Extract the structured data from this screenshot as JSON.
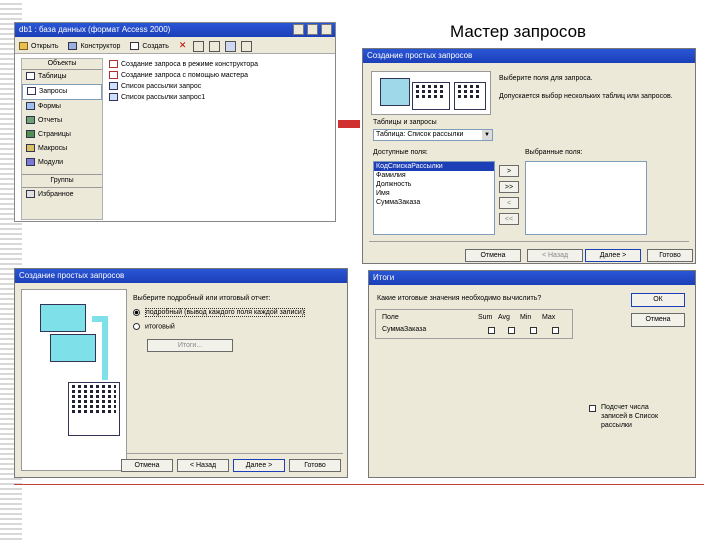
{
  "page": {
    "heading": "Мастер запросов"
  },
  "db_window": {
    "title": "db1 : база данных (формат Access 2000)",
    "toolbar": {
      "open": "Открыть",
      "designer": "Конструктор",
      "create": "Создать"
    },
    "objects_header": "Объекты",
    "objects": [
      "Таблицы",
      "Запросы",
      "Формы",
      "Отчеты",
      "Страницы",
      "Макросы",
      "Модули"
    ],
    "groups_header": "Группы",
    "groups": [
      "Избранное"
    ],
    "list_items": [
      "Создание запроса в режиме конструктора",
      "Создание запроса с помощью мастера",
      "Список рассылки запрос",
      "Список рассылки запрос1"
    ]
  },
  "wizard1": {
    "title": "Создание простых запросов",
    "instruction": "Выберите поля для запроса.",
    "hint": "Допускается выбор нескольких таблиц или запросов.",
    "tables_label": "Таблицы и запросы",
    "tables_value": "Таблица: Список рассылки",
    "available_label": "Доступные поля:",
    "selected_label": "Выбранные поля:",
    "available_fields": [
      "КодСпискаРассылки",
      "Фамилия",
      "Должность",
      "Имя",
      "СуммаЗаказа"
    ],
    "move_buttons": [
      ">",
      ">>",
      "<",
      "<<"
    ],
    "buttons": {
      "cancel": "Отмена",
      "back": "< Назад",
      "next": "Далее >",
      "finish": "Готово"
    }
  },
  "wizard2": {
    "title": "Создание простых запросов",
    "question": "Выберите подробный или итоговый отчет:",
    "options": [
      "подробный (вывод каждого поля каждой записи)",
      "итоговый"
    ],
    "totals_button": "Итоги...",
    "buttons": {
      "cancel": "Отмена",
      "back": "< Назад",
      "next": "Далее >",
      "finish": "Готово"
    }
  },
  "totals": {
    "title": "Итоги",
    "question": "Какие итоговые значения необходимо вычислить?",
    "columns": [
      "Поле",
      "Sum",
      "Avg",
      "Min",
      "Max"
    ],
    "rows": [
      {
        "field": "СуммаЗаказа"
      }
    ],
    "ok": "ОК",
    "cancel": "Отмена",
    "count_label": "Подсчет числа записей в Список рассылки"
  },
  "colors": {
    "title_bar": "#2a56d6",
    "arrow": "#d03030",
    "panel": "#ece9d8",
    "preview": "#7ee0e8"
  }
}
